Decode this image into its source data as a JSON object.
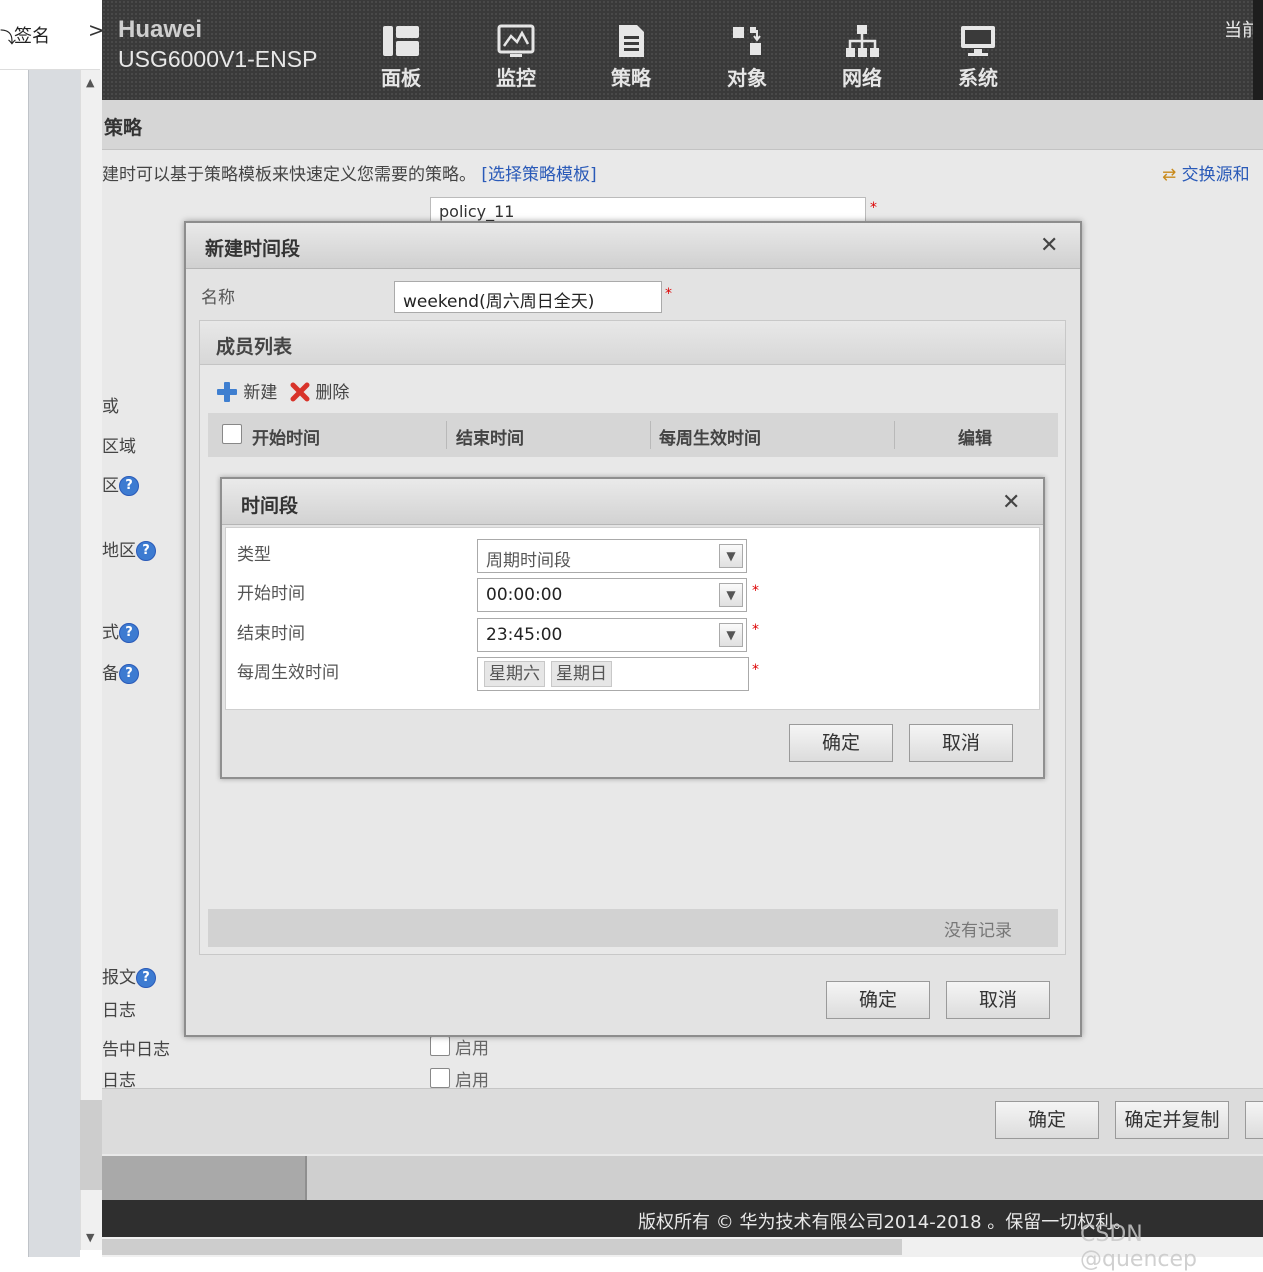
{
  "left_panel": {
    "prefix": "⤵",
    "tab_label": "签名",
    "chevron": ">"
  },
  "header": {
    "brand_line1": "Huawei",
    "brand_line2": "USG6000V1-ENSP",
    "nav": [
      {
        "label": "面板",
        "icon": "dashboard-icon"
      },
      {
        "label": "监控",
        "icon": "monitor-icon"
      },
      {
        "label": "策略",
        "icon": "policy-icon"
      },
      {
        "label": "对象",
        "icon": "object-icon"
      },
      {
        "label": "网络",
        "icon": "network-icon"
      },
      {
        "label": "系统",
        "icon": "system-icon"
      }
    ],
    "current_label": "当前"
  },
  "page": {
    "title": "策略",
    "hint_text": "建时可以基于策略模板来快速定义您需要的策略。",
    "template_link": "[选择策略模板]",
    "swap_link": "交换源和",
    "policy_name": "policy_11",
    "side_labels": [
      "或",
      "区域",
      "区",
      "地区",
      "式",
      "备",
      "报文",
      "日志",
      "告中日志",
      "日志"
    ],
    "enable_label": "启用"
  },
  "dialog_new_period": {
    "title": "新建时间段",
    "name_label": "名称",
    "name_value": "weekend(周六周日全天)",
    "members_title": "成员列表",
    "toolbar": {
      "new_label": "新建",
      "delete_label": "删除"
    },
    "columns": [
      "开始时间",
      "结束时间",
      "每周生效时间",
      "编辑"
    ],
    "no_records": "没有记录",
    "ok_label": "确定",
    "cancel_label": "取消"
  },
  "dialog_period": {
    "title": "时间段",
    "type_label": "类型",
    "type_value": "周期时间段",
    "start_label": "开始时间",
    "start_value": "00:00:00",
    "end_label": "结束时间",
    "end_value": "23:45:00",
    "weekly_label": "每周生效时间",
    "weekly_days": [
      "星期六",
      "星期日"
    ],
    "ok_label": "确定",
    "cancel_label": "取消"
  },
  "page_footer": {
    "ok_label": "确定",
    "ok_copy_label": "确定并复制",
    "copyright": "版权所有 © 华为技术有限公司2014-2018 。保留一切权利。",
    "watermark": "CSDN @quencep"
  },
  "colors": {
    "accent_link": "#2a5ab8",
    "header_bg": "#3a3a3a",
    "required_mark": "#dd0000"
  }
}
